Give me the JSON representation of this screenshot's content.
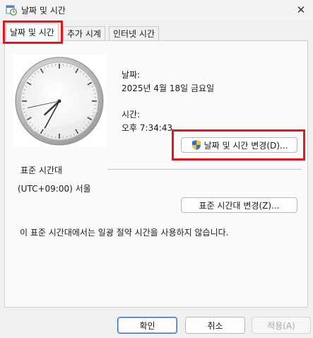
{
  "window": {
    "title": "날짜 및 시간",
    "close_glyph": "✕"
  },
  "tabs": [
    {
      "label": "날짜 및 시간",
      "active": true
    },
    {
      "label": "추가 시계",
      "active": false
    },
    {
      "label": "인터넷 시간",
      "active": false
    }
  ],
  "date_section": {
    "date_label": "날짜:",
    "date_value": "2025년 4월 18일 금요일",
    "time_label": "시간:",
    "time_value": "오후 7:34:43",
    "change_button": "날짜 및 시간 변경(D)..."
  },
  "timezone_section": {
    "heading": "표준 시간대",
    "value": "(UTC+09:00) 서울",
    "change_button": "표준 시간대 변경(Z)..."
  },
  "dst_message": "이 표준 시간대에서는 일광 절약 시간을 사용하지 않습니다.",
  "footer": {
    "ok": "확인",
    "cancel": "취소",
    "apply": "적용(A)"
  },
  "clock": {
    "hour": 7,
    "minute": 34,
    "second": 43
  },
  "icons": {
    "app": "date-time-icon",
    "shield": "uac-shield-icon",
    "close": "close-icon"
  },
  "colors": {
    "highlight": "#e8161c",
    "primary_border": "#3b6dbf"
  }
}
